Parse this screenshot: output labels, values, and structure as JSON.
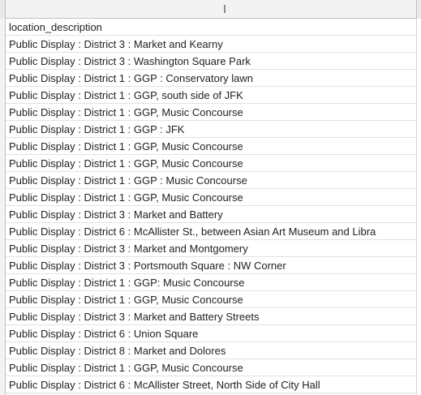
{
  "sheet": {
    "column_header": {
      "label": ""
    },
    "header_cell": "location_description",
    "rows": [
      "Public Display : District 3 : Market and Kearny",
      "Public Display : District 3 : Washington Square Park",
      "Public Display : District 1 : GGP : Conservatory lawn",
      "Public Display : District 1 : GGP, south side of JFK",
      "Public Display : District 1 : GGP, Music Concourse",
      "Public Display : District 1 : GGP : JFK",
      "Public Display : District 1 : GGP, Music Concourse",
      "Public Display : District 1 : GGP, Music Concourse",
      "Public Display : District 1 : GGP : Music Concourse",
      "Public Display : District 1 : GGP, Music Concourse",
      "Public Display : District 3 : Market and Battery",
      "Public Display : District 6 : McAllister St., between Asian Art Museum and Libra",
      "Public Display : District 3 : Market and Montgomery",
      "Public Display : District 3 : Portsmouth Square : NW Corner",
      "Public Display : District 1 : GGP: Music Concourse",
      "Public Display : District 1 : GGP, Music Concourse",
      "Public Display : District 3 : Market and Battery Streets",
      "Public Display : District 6 : Union Square",
      "Public Display : District 8 : Market and Dolores",
      "Public Display : District 1 : GGP, Music Concourse",
      "Public Display : District 6 : McAllister Street, North Side of City Hall"
    ]
  }
}
